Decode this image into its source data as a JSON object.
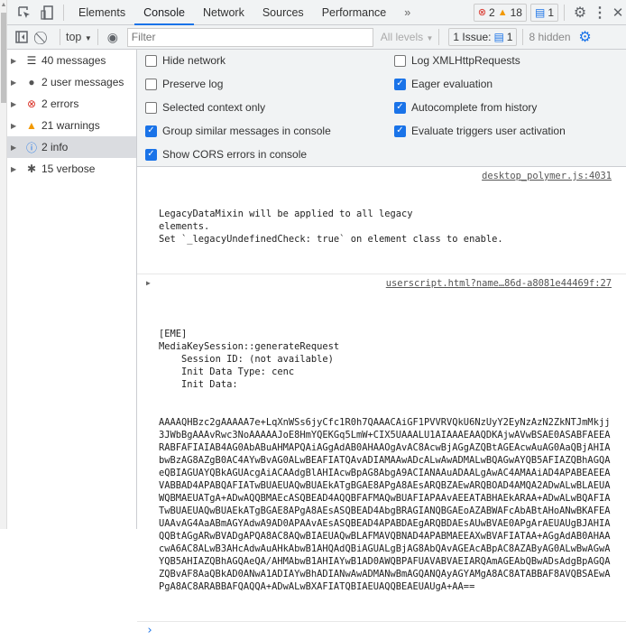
{
  "tabs": {
    "items": [
      "Elements",
      "Console",
      "Network",
      "Sources",
      "Performance"
    ],
    "more": "»",
    "active": "Console"
  },
  "badges": {
    "errors": "2",
    "warnings": "18",
    "issues": "1"
  },
  "toolbar": {
    "context": "top",
    "filter_placeholder": "Filter",
    "levels": "All levels",
    "issue_label": "1 Issue:",
    "issue_count": "1",
    "hidden": "8 hidden"
  },
  "sidebar": {
    "items": [
      {
        "label": "40 messages",
        "icon": "list-icon"
      },
      {
        "label": "2 user messages",
        "icon": "user-icon"
      },
      {
        "label": "2 errors",
        "icon": "error-icon"
      },
      {
        "label": "21 warnings",
        "icon": "warning-icon"
      },
      {
        "label": "2 info",
        "icon": "info-icon"
      },
      {
        "label": "15 verbose",
        "icon": "bug-icon"
      }
    ]
  },
  "settings": {
    "left": [
      {
        "label": "Hide network",
        "checked": false
      },
      {
        "label": "Preserve log",
        "checked": false
      },
      {
        "label": "Selected context only",
        "checked": false
      },
      {
        "label": "Group similar messages in console",
        "checked": true
      },
      {
        "label": "Show CORS errors in console",
        "checked": true
      }
    ],
    "right": [
      {
        "label": "Log XMLHttpRequests",
        "checked": false
      },
      {
        "label": "Eager evaluation",
        "checked": true
      },
      {
        "label": "Autocomplete from history",
        "checked": true
      },
      {
        "label": "Evaluate triggers user activation",
        "checked": true
      }
    ]
  },
  "messages": [
    {
      "text": "LegacyDataMixin will be applied to all legacy\nelements.\nSet `_legacyUndefinedCheck: true` on element class to enable.",
      "source": "desktop_polymer.js:4031"
    },
    {
      "text": "[EME]\nMediaKeySession::generateRequest\n    Session ID: (not available)\n    Init Data Type: cenc\n    Init Data:",
      "source": "userscript.html?name…86d-a8081e44469f:27",
      "data": "AAAAQHBzc2gAAAAA7e+LqXnWSs6jyCfc1R0h7QAAACAiGF1PVVRVQkU6NzUyY2EyNzAzN2ZkNTJmMkjj3JWbBgAAAvRwc3NoAAAAAJoE8HmYQEKGq5LmW+CIX5UAAALU1AIAAAEAAQDKAjwAVwBSAE0ASABFAEEARABFAFIAIAB4AG0AbABuAHMAPQAiAGgAdAB0AHAAOgAvAC8AcwBjAGgAZQBtAGEAcwAuAG0AaQBjAHIAbwBzAG8AZgB0AC4AYwBvAG0ALwBEAFIATQAvADIAMAAwADcALwAwADMALwBQAGwAYQB5AFIAZQBhAGQAeQBIAGUAYQBkAGUAcgAiACAAdgBlAHIAcwBpAG8AbgA9ACIANAAuADAALgAwAC4AMAAiAD4APABEAEEAVABBAD4APABQAFIATwBUAEUAQwBUAEkATgBGAE8APgA8AEsARQBZAEwARQBOAD4AMQA2ADwALwBLAEUAWQBMAEUATgA+ADwAQQBMAEcASQBEAD4AQQBFAFMAQwBUAFIAPAAvAEEATABHAEkARAA+ADwALwBQAFIATwBUAEUAQwBUAEkATgBGAE8APgA8AEsASQBEAD4AbgBRAGIANQBGAEoAZABWAFcAbABtAHoANwBKAFEAUAAvAG4AaABmAGYAdwA9AD0APAAvAEsASQBEAD4APABDAEgARQBDAEsAUwBVAE0APgArAEUAUgBJAHIAQQBtAGgARwBVADgAPQA8AC8AQwBIAEUAQwBLAFMAVQBNAD4APABMAEEAXwBVAFIATAA+AGgAdAB0AHAAcwA6AC8ALwB3AHcAdwAuAHkAbwB1AHQAdQBiAGUALgBjAG8AbQAvAGEAcABpAC8AZAByAG0ALwBwAGwAYQB5AHIAZQBhAGQAeQA/AHMAbwB1AHIAYwB1AD0AWQBPAFUAVABVAEIARQAmAGEAbQBwADsAdgBpAGQAZQBvAF8AaQBkAD0ANwA1ADIAYwBhADIANwAwADMANwBmAGQANQAyAGYAMgA8AC8ATABBAF8AVQBSAEwAPgA8AC8ARABBAFQAQQA+ADwALwBXAFIATQBIAEUAQQBEAEUAUgA+AA=="
    }
  ],
  "prompt": "›"
}
